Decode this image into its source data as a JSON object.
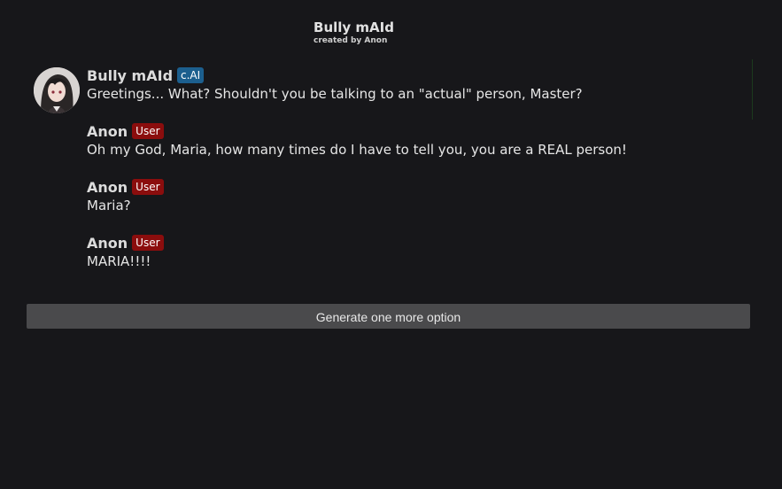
{
  "header": {
    "title": "Bully mAId",
    "created_by": "created by Anon"
  },
  "messages": [
    {
      "name": "Bully mAId",
      "badge": "c.AI",
      "text": "Greetings... What? Shouldn't you be talking to an \"actual\" person, Master?"
    },
    {
      "name": "Anon",
      "badge": "User",
      "text": "Oh my God, Maria, how many times do I have to tell you, you are a REAL person!"
    },
    {
      "name": "Anon",
      "badge": "User",
      "text": "Maria?"
    },
    {
      "name": "Anon",
      "badge": "User",
      "text": "MARIA!!!!"
    }
  ],
  "actions": {
    "generate_label": "Generate one more option"
  },
  "colors": {
    "background": "#17171a",
    "cai_badge": "#1c5f8e",
    "user_badge": "#8b0d0d",
    "button": "#4a4a4c"
  }
}
